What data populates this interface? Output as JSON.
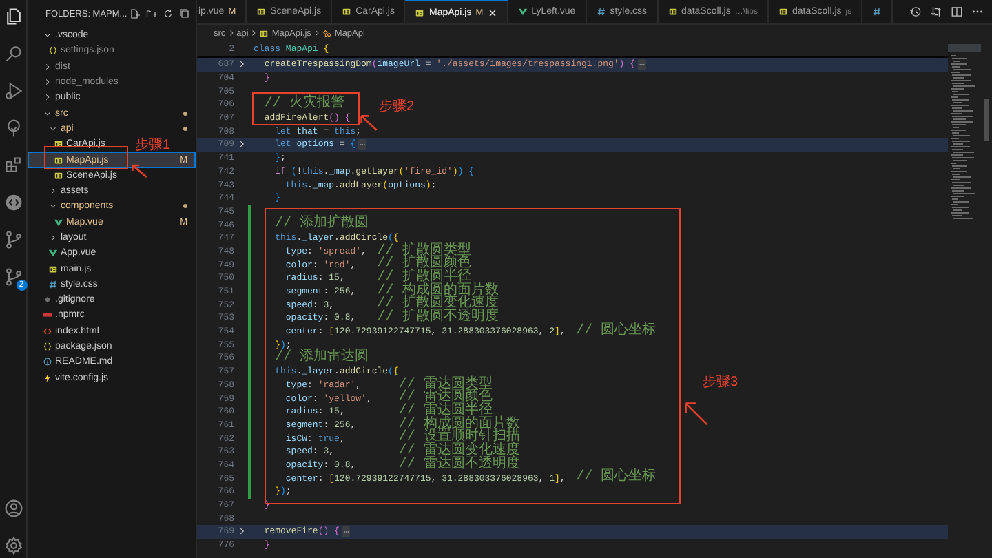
{
  "activity_bar": {
    "items": [
      {
        "kind": "explorer",
        "selected": true
      },
      {
        "kind": "search",
        "selected": false
      },
      {
        "kind": "run",
        "selected": false
      },
      {
        "kind": "tree",
        "selected": false
      },
      {
        "kind": "extensions",
        "selected": false
      },
      {
        "kind": "chat",
        "selected": false
      },
      {
        "kind": "source-control",
        "selected": false
      },
      {
        "kind": "source-control",
        "selected": false,
        "badge": "2"
      }
    ],
    "bottom_items": [
      {
        "kind": "account",
        "selected": false
      },
      {
        "kind": "settings",
        "selected": false
      }
    ]
  },
  "sidebar": {
    "title": "FOLDERS: MAPM...",
    "tree": [
      {
        "name": ".vscode",
        "kind": "folder",
        "expanded": true,
        "modified": false,
        "ignored": false,
        "selected": false,
        "children": [
          {
            "name": "settings.json",
            "kind": "json",
            "modified": false,
            "ignored": true,
            "selected": false
          }
        ]
      },
      {
        "name": "dist",
        "kind": "folder",
        "expanded": false,
        "modified": false,
        "ignored": true,
        "selected": false
      },
      {
        "name": "node_modules",
        "kind": "folder",
        "expanded": false,
        "modified": false,
        "ignored": true,
        "selected": false
      },
      {
        "name": "public",
        "kind": "folder",
        "expanded": false,
        "modified": false,
        "ignored": false,
        "selected": false
      },
      {
        "name": "src",
        "kind": "folder",
        "expanded": true,
        "modified": true,
        "ignored": false,
        "selected": false,
        "children": [
          {
            "name": "api",
            "kind": "folder",
            "expanded": true,
            "modified": true,
            "ignored": false,
            "selected": false,
            "children": [
              {
                "name": "CarApi.js",
                "kind": "js",
                "modified": false,
                "ignored": false,
                "selected": false
              },
              {
                "name": "MapApi.js",
                "kind": "js",
                "modified": true,
                "ignored": false,
                "badge": "M",
                "selected": true
              },
              {
                "name": "SceneApi.js",
                "kind": "js",
                "modified": false,
                "ignored": false,
                "selected": false
              }
            ]
          },
          {
            "name": "assets",
            "kind": "folder",
            "expanded": false,
            "modified": false,
            "ignored": false,
            "selected": false
          },
          {
            "name": "components",
            "kind": "folder",
            "expanded": true,
            "modified": true,
            "ignored": false,
            "selected": false,
            "children": [
              {
                "name": "Map.vue",
                "kind": "vue",
                "modified": true,
                "ignored": false,
                "badge": "M",
                "selected": false
              }
            ]
          },
          {
            "name": "layout",
            "kind": "folder",
            "expanded": false,
            "modified": false,
            "ignored": false,
            "selected": false
          },
          {
            "name": "App.vue",
            "kind": "vue",
            "modified": false,
            "ignored": false,
            "selected": false
          },
          {
            "name": "main.js",
            "kind": "js",
            "modified": false,
            "ignored": false,
            "selected": false
          },
          {
            "name": "style.css",
            "kind": "css",
            "modified": false,
            "ignored": false,
            "selected": false
          }
        ]
      },
      {
        "name": ".gitignore",
        "kind": "gitignore",
        "modified": false,
        "ignored": false,
        "selected": false
      },
      {
        "name": ".npmrc",
        "kind": "npmrc",
        "modified": false,
        "ignored": false,
        "selected": false
      },
      {
        "name": "index.html",
        "kind": "html",
        "modified": false,
        "ignored": false,
        "selected": false
      },
      {
        "name": "package.json",
        "kind": "json",
        "modified": false,
        "ignored": false,
        "selected": false
      },
      {
        "name": "README.md",
        "kind": "md",
        "modified": false,
        "ignored": false,
        "selected": false
      },
      {
        "name": "vite.config.js",
        "kind": "vite",
        "modified": false,
        "ignored": false,
        "selected": false
      }
    ]
  },
  "tabs": [
    {
      "label": "ip.vue",
      "badge": "M",
      "selected": false
    },
    {
      "label": "SceneApi.js",
      "kind": "js",
      "selected": false
    },
    {
      "label": "CarApi.js",
      "kind": "js",
      "selected": false
    },
    {
      "label": "MapApi.js",
      "kind": "js",
      "badge": "M",
      "selected": true
    },
    {
      "label": "LyLeft.vue",
      "kind": "vue",
      "selected": false
    },
    {
      "label": "style.css",
      "kind": "css",
      "selected": false
    },
    {
      "label": "dataScoll.js",
      "kind": "js",
      "description": "…\\libs",
      "selected": false
    },
    {
      "label": "dataScoll.js",
      "kind": "js",
      "description": "js",
      "selected": false
    },
    {
      "kind": "css",
      "selected": false
    }
  ],
  "breadcrumb": [
    {
      "kind": "folder",
      "label": "src"
    },
    {
      "kind": "folder",
      "label": "api"
    },
    {
      "kind": "js",
      "label": "MapApi.js"
    },
    {
      "kind": "class",
      "label": "MapApi"
    }
  ],
  "editor": {
    "sticky_line": {
      "number": "2",
      "tokens": [
        {
          "kind": "kw",
          "text": "class"
        },
        {
          "kind": "cls",
          "text": " MapApi"
        },
        {
          "kind": "b1",
          "text": " {"
        }
      ]
    },
    "lines": [
      {
        "number": "687",
        "folded": true,
        "changed": false,
        "tokens": [
          {
            "kind": "fn",
            "text": "  createTrespassingDom"
          },
          {
            "kind": "b2",
            "text": "("
          },
          {
            "kind": "prop",
            "text": "imageUrl"
          },
          {
            "kind": "p",
            "text": " = "
          },
          {
            "kind": "str",
            "text": "'./assets/images/trespassing1.png'"
          },
          {
            "kind": "b2",
            "text": ")"
          },
          {
            "kind": "b2",
            "text": " {"
          },
          {
            "kind": "fold",
            "text": "⋯"
          }
        ]
      },
      {
        "number": "704",
        "folded": false,
        "changed": false,
        "tokens": [
          {
            "kind": "b2",
            "text": "  }"
          }
        ]
      },
      {
        "number": "705",
        "folded": false,
        "changed": false
      },
      {
        "number": "706",
        "folded": false,
        "changed": false,
        "tokens": [
          {
            "kind": "cmt",
            "text": "  // 火灾报警"
          }
        ]
      },
      {
        "number": "707",
        "folded": false,
        "changed": false,
        "tokens": [
          {
            "kind": "fn",
            "text": "  addFireAlert"
          },
          {
            "kind": "b2",
            "text": "()"
          },
          {
            "kind": "b2",
            "text": " {"
          }
        ]
      },
      {
        "number": "708",
        "folded": false,
        "changed": false,
        "tokens": [
          {
            "kind": "kw",
            "text": "    let"
          },
          {
            "kind": "prop",
            "text": " that"
          },
          {
            "kind": "p",
            "text": " = "
          },
          {
            "kind": "kw",
            "text": "this"
          },
          {
            "kind": "p",
            "text": ";"
          }
        ]
      },
      {
        "number": "709",
        "folded": true,
        "changed": false,
        "tokens": [
          {
            "kind": "kw",
            "text": "    let"
          },
          {
            "kind": "prop",
            "text": " options"
          },
          {
            "kind": "p",
            "text": " = "
          },
          {
            "kind": "b3",
            "text": "{"
          },
          {
            "kind": "fold",
            "text": "⋯"
          }
        ]
      },
      {
        "number": "741",
        "folded": false,
        "changed": false,
        "tokens": [
          {
            "kind": "b3",
            "text": "    }"
          },
          {
            "kind": "p",
            "text": ";"
          }
        ]
      },
      {
        "number": "742",
        "folded": false,
        "changed": false,
        "tokens": [
          {
            "kind": "kw2",
            "text": "    if"
          },
          {
            "kind": "b3",
            "text": " ("
          },
          {
            "kind": "p",
            "text": "!"
          },
          {
            "kind": "kw",
            "text": "this"
          },
          {
            "kind": "p",
            "text": "."
          },
          {
            "kind": "prop",
            "text": "_map"
          },
          {
            "kind": "p",
            "text": "."
          },
          {
            "kind": "fn",
            "text": "getLayer"
          },
          {
            "kind": "b1",
            "text": "("
          },
          {
            "kind": "str",
            "text": "'fire_id'"
          },
          {
            "kind": "b1",
            "text": ")"
          },
          {
            "kind": "b3",
            "text": ")"
          },
          {
            "kind": "b3",
            "text": " {"
          }
        ]
      },
      {
        "number": "743",
        "folded": false,
        "changed": false,
        "tokens": [
          {
            "kind": "kw",
            "text": "      this"
          },
          {
            "kind": "p",
            "text": "."
          },
          {
            "kind": "prop",
            "text": "_map"
          },
          {
            "kind": "p",
            "text": "."
          },
          {
            "kind": "fn",
            "text": "addLayer"
          },
          {
            "kind": "b1",
            "text": "("
          },
          {
            "kind": "prop",
            "text": "options"
          },
          {
            "kind": "b1",
            "text": ")"
          },
          {
            "kind": "p",
            "text": ";"
          }
        ]
      },
      {
        "number": "744",
        "folded": false,
        "changed": false,
        "tokens": [
          {
            "kind": "b3",
            "text": "    }"
          }
        ]
      },
      {
        "number": "745",
        "folded": false,
        "changed": true
      },
      {
        "number": "746",
        "folded": false,
        "changed": true,
        "tokens": [
          {
            "kind": "cmt",
            "text": "    // 添加扩散圆"
          }
        ]
      },
      {
        "number": "747",
        "folded": false,
        "changed": true,
        "tokens": [
          {
            "kind": "kw",
            "text": "    this"
          },
          {
            "kind": "p",
            "text": "."
          },
          {
            "kind": "prop",
            "text": "_layer"
          },
          {
            "kind": "p",
            "text": "."
          },
          {
            "kind": "fn",
            "text": "addCircle"
          },
          {
            "kind": "b3",
            "text": "("
          },
          {
            "kind": "b1",
            "text": "{"
          }
        ]
      },
      {
        "number": "748",
        "folded": false,
        "changed": true,
        "tokens": [
          {
            "kind": "prop",
            "text": "      type"
          },
          {
            "kind": "p",
            "text": ": "
          },
          {
            "kind": "str",
            "text": "'spread'"
          },
          {
            "kind": "p",
            "text": ","
          },
          {
            "kind": "cmt",
            "text": "  // 扩散圆类型"
          }
        ]
      },
      {
        "number": "749",
        "folded": false,
        "changed": true,
        "tokens": [
          {
            "kind": "prop",
            "text": "      color"
          },
          {
            "kind": "p",
            "text": ": "
          },
          {
            "kind": "str",
            "text": "'red'"
          },
          {
            "kind": "p",
            "text": ","
          },
          {
            "kind": "cmt",
            "text": "    // 扩散圆颜色"
          }
        ]
      },
      {
        "number": "750",
        "folded": false,
        "changed": true,
        "tokens": [
          {
            "kind": "prop",
            "text": "      radius"
          },
          {
            "kind": "p",
            "text": ": "
          },
          {
            "kind": "num",
            "text": "15"
          },
          {
            "kind": "p",
            "text": ","
          },
          {
            "kind": "cmt",
            "text": "      // 扩散圆半径"
          }
        ]
      },
      {
        "number": "751",
        "folded": false,
        "changed": true,
        "tokens": [
          {
            "kind": "prop",
            "text": "      segment"
          },
          {
            "kind": "p",
            "text": ": "
          },
          {
            "kind": "num",
            "text": "256"
          },
          {
            "kind": "p",
            "text": ","
          },
          {
            "kind": "cmt",
            "text": "    // 构成圆的面片数"
          }
        ]
      },
      {
        "number": "752",
        "folded": false,
        "changed": true,
        "tokens": [
          {
            "kind": "prop",
            "text": "      speed"
          },
          {
            "kind": "p",
            "text": ": "
          },
          {
            "kind": "num",
            "text": "3"
          },
          {
            "kind": "p",
            "text": ","
          },
          {
            "kind": "cmt",
            "text": "        // 扩散圆变化速度"
          }
        ]
      },
      {
        "number": "753",
        "folded": false,
        "changed": true,
        "tokens": [
          {
            "kind": "prop",
            "text": "      opacity"
          },
          {
            "kind": "p",
            "text": ": "
          },
          {
            "kind": "num",
            "text": "0.8"
          },
          {
            "kind": "p",
            "text": ","
          },
          {
            "kind": "cmt",
            "text": "    // 扩散圆不透明度"
          }
        ]
      },
      {
        "number": "754",
        "folded": false,
        "changed": true,
        "tokens": [
          {
            "kind": "prop",
            "text": "      center"
          },
          {
            "kind": "p",
            "text": ": "
          },
          {
            "kind": "b1",
            "text": "["
          },
          {
            "kind": "num",
            "text": "120.72939122747715"
          },
          {
            "kind": "p",
            "text": ", "
          },
          {
            "kind": "num",
            "text": "31.288303376028963"
          },
          {
            "kind": "p",
            "text": ", "
          },
          {
            "kind": "num",
            "text": "2"
          },
          {
            "kind": "b1",
            "text": "]"
          },
          {
            "kind": "p",
            "text": ","
          },
          {
            "kind": "cmt",
            "text": "  // 圆心坐标"
          }
        ]
      },
      {
        "number": "755",
        "folded": false,
        "changed": true,
        "tokens": [
          {
            "kind": "b1",
            "text": "    }"
          },
          {
            "kind": "b3",
            "text": ")"
          },
          {
            "kind": "p",
            "text": ";"
          }
        ]
      },
      {
        "number": "756",
        "folded": false,
        "changed": true,
        "tokens": [
          {
            "kind": "cmt",
            "text": "    // 添加雷达圆"
          }
        ]
      },
      {
        "number": "757",
        "folded": false,
        "changed": true,
        "tokens": [
          {
            "kind": "kw",
            "text": "    this"
          },
          {
            "kind": "p",
            "text": "."
          },
          {
            "kind": "prop",
            "text": "_layer"
          },
          {
            "kind": "p",
            "text": "."
          },
          {
            "kind": "fn",
            "text": "addCircle"
          },
          {
            "kind": "b3",
            "text": "("
          },
          {
            "kind": "b1",
            "text": "{"
          }
        ]
      },
      {
        "number": "758",
        "folded": false,
        "changed": true,
        "tokens": [
          {
            "kind": "prop",
            "text": "      type"
          },
          {
            "kind": "p",
            "text": ": "
          },
          {
            "kind": "str",
            "text": "'radar'"
          },
          {
            "kind": "p",
            "text": ","
          },
          {
            "kind": "cmt",
            "text": "       // 雷达圆类型"
          }
        ]
      },
      {
        "number": "759",
        "folded": false,
        "changed": true,
        "tokens": [
          {
            "kind": "prop",
            "text": "      color"
          },
          {
            "kind": "p",
            "text": ": "
          },
          {
            "kind": "str",
            "text": "'yellow'"
          },
          {
            "kind": "p",
            "text": ","
          },
          {
            "kind": "cmt",
            "text": "     // 雷达圆颜色"
          }
        ]
      },
      {
        "number": "760",
        "folded": false,
        "changed": true,
        "tokens": [
          {
            "kind": "prop",
            "text": "      radius"
          },
          {
            "kind": "p",
            "text": ": "
          },
          {
            "kind": "num",
            "text": "15"
          },
          {
            "kind": "p",
            "text": ","
          },
          {
            "kind": "cmt",
            "text": "          // 雷达圆半径"
          }
        ]
      },
      {
        "number": "761",
        "folded": false,
        "changed": true,
        "tokens": [
          {
            "kind": "prop",
            "text": "      segment"
          },
          {
            "kind": "p",
            "text": ": "
          },
          {
            "kind": "num",
            "text": "256"
          },
          {
            "kind": "p",
            "text": ","
          },
          {
            "kind": "cmt",
            "text": "        // 构成圆的面片数"
          }
        ]
      },
      {
        "number": "762",
        "folded": false,
        "changed": true,
        "tokens": [
          {
            "kind": "prop",
            "text": "      isCW"
          },
          {
            "kind": "p",
            "text": ": "
          },
          {
            "kind": "kw",
            "text": "true"
          },
          {
            "kind": "p",
            "text": ","
          },
          {
            "kind": "cmt",
            "text": "          // 设置顺时针扫描"
          }
        ]
      },
      {
        "number": "763",
        "folded": false,
        "changed": true,
        "tokens": [
          {
            "kind": "prop",
            "text": "      speed"
          },
          {
            "kind": "p",
            "text": ": "
          },
          {
            "kind": "num",
            "text": "3"
          },
          {
            "kind": "p",
            "text": ","
          },
          {
            "kind": "cmt",
            "text": "            // 雷达圆变化速度"
          }
        ]
      },
      {
        "number": "764",
        "folded": false,
        "changed": true,
        "tokens": [
          {
            "kind": "prop",
            "text": "      opacity"
          },
          {
            "kind": "p",
            "text": ": "
          },
          {
            "kind": "num",
            "text": "0.8"
          },
          {
            "kind": "p",
            "text": ","
          },
          {
            "kind": "cmt",
            "text": "        // 雷达圆不透明度"
          }
        ]
      },
      {
        "number": "765",
        "folded": false,
        "changed": true,
        "tokens": [
          {
            "kind": "prop",
            "text": "      center"
          },
          {
            "kind": "p",
            "text": ": "
          },
          {
            "kind": "b1",
            "text": "["
          },
          {
            "kind": "num",
            "text": "120.72939122747715"
          },
          {
            "kind": "p",
            "text": ", "
          },
          {
            "kind": "num",
            "text": "31.288303376028963"
          },
          {
            "kind": "p",
            "text": ", "
          },
          {
            "kind": "num",
            "text": "1"
          },
          {
            "kind": "b1",
            "text": "]"
          },
          {
            "kind": "p",
            "text": ","
          },
          {
            "kind": "cmt",
            "text": "  // 圆心坐标"
          }
        ]
      },
      {
        "number": "766",
        "folded": false,
        "changed": true,
        "tokens": [
          {
            "kind": "b1",
            "text": "    }"
          },
          {
            "kind": "b3",
            "text": ")"
          },
          {
            "kind": "p",
            "text": ";"
          }
        ]
      },
      {
        "number": "767",
        "folded": false,
        "changed": false,
        "tokens": [
          {
            "kind": "b2",
            "text": "  }"
          }
        ]
      },
      {
        "number": "768",
        "folded": false,
        "changed": false
      },
      {
        "number": "769",
        "folded": true,
        "changed": false,
        "tokens": [
          {
            "kind": "fn",
            "text": "  removeFire"
          },
          {
            "kind": "b2",
            "text": "()"
          },
          {
            "kind": "b2",
            "text": " {"
          },
          {
            "kind": "fold",
            "text": "⋯"
          }
        ]
      },
      {
        "number": "776",
        "folded": false,
        "changed": false,
        "tokens": [
          {
            "kind": "b2",
            "text": "  }"
          }
        ]
      }
    ]
  },
  "annotations": [
    {
      "label": "步骤1"
    },
    {
      "label": "步骤2"
    },
    {
      "label": "步骤3"
    }
  ]
}
